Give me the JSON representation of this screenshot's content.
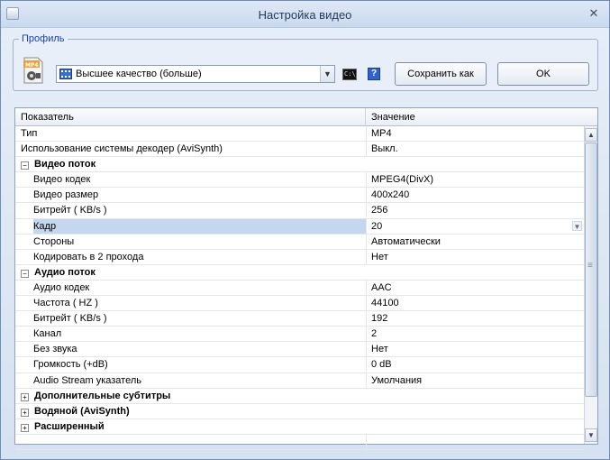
{
  "window": {
    "title": "Настройка видео"
  },
  "profile": {
    "legend": "Профиль",
    "selected": "Высшее качество (больше)",
    "icon_text": "MP4",
    "save_label": "Сохранить как",
    "ok_label": "OK",
    "help_glyph": "?"
  },
  "grid": {
    "col_name": "Показатель",
    "col_value": "Значение",
    "rows": [
      {
        "type": "item",
        "name": "Тип",
        "value": "MP4"
      },
      {
        "type": "item",
        "name": "Использование системы декодер (AviSynth)",
        "value": "Выкл."
      },
      {
        "type": "cat",
        "name": "Видео поток",
        "glyph": "−"
      },
      {
        "type": "child",
        "name": "Видео кодек",
        "value": "MPEG4(DivX)"
      },
      {
        "type": "child",
        "name": "Видео размер",
        "value": "400x240"
      },
      {
        "type": "child",
        "name": "Битрейт ( KB/s )",
        "value": "256"
      },
      {
        "type": "sel",
        "name": "Кадр",
        "value": "20"
      },
      {
        "type": "child",
        "name": "Стороны",
        "value": "Автоматически"
      },
      {
        "type": "child",
        "name": "Кодировать в 2 прохода",
        "value": "Нет"
      },
      {
        "type": "cat",
        "name": "Аудио поток",
        "glyph": "−"
      },
      {
        "type": "child",
        "name": "Аудио кодек",
        "value": "AAC"
      },
      {
        "type": "child",
        "name": "Частота ( HZ )",
        "value": "44100"
      },
      {
        "type": "child",
        "name": "Битрейт ( KB/s )",
        "value": "192"
      },
      {
        "type": "child",
        "name": "Канал",
        "value": "2"
      },
      {
        "type": "child",
        "name": "Без звука",
        "value": "Нет"
      },
      {
        "type": "child",
        "name": "Громкость (+dB)",
        "value": "0 dB"
      },
      {
        "type": "child",
        "name": "Audio Stream указатель",
        "value": "Умолчания"
      },
      {
        "type": "cat",
        "name": "Дополнительные субтитры",
        "glyph": "+"
      },
      {
        "type": "cat",
        "name": "Водяной (AviSynth)",
        "glyph": "+"
      },
      {
        "type": "cat",
        "name": "Расширенный",
        "glyph": "+"
      },
      {
        "type": "empty",
        "name": "",
        "value": ""
      }
    ]
  }
}
